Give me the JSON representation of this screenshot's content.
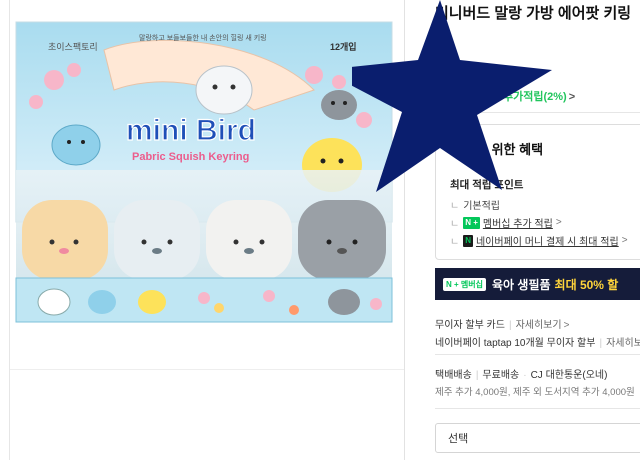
{
  "product": {
    "title": "미니버드 말랑 가방 에어팟 키링",
    "image": {
      "brand_text": "초이스팩토리",
      "count_text": "12개입",
      "headline": "mini Bird",
      "subheadline": "Pabric Squish Keyring",
      "tagline": "말랑하고 보들보들한 내 손안의 힐링 새 키링"
    }
  },
  "points": {
    "line": "드 최대 138원 추가적립(2%)",
    "chevron": ">"
  },
  "benefits": {
    "title": "을 위한 혜택",
    "subtitle": "최대 적립 포인트",
    "rows": [
      {
        "label": "기본적립",
        "badge": ""
      },
      {
        "label": "멤버십 추가 적립",
        "badge": "N +"
      },
      {
        "label": "네이버페이 머니 결제 시 최대 적립",
        "badge": "N"
      }
    ],
    "chevron": ">"
  },
  "banner": {
    "tag": "N + 멤버십",
    "text": "육아 생필품",
    "highlight": "최대 50% 할"
  },
  "installment": {
    "label": "무이자 할부 카드",
    "link": "자세히보기",
    "detail": "네이버페이 taptap 10개월 무이자 할부",
    "detail_link": "자세히보"
  },
  "shipping": {
    "type": "택배배송",
    "fee": "무료배송",
    "carrier": "CJ 대한통운(오네)",
    "extra": "제주 추가 4,000원, 제주 외 도서지역 추가 4,000원"
  },
  "option_select": {
    "placeholder": "선택"
  },
  "colors": {
    "point_green": "#21c55d",
    "banner_bg": "#151c3a",
    "star": "#0a1e6e"
  }
}
